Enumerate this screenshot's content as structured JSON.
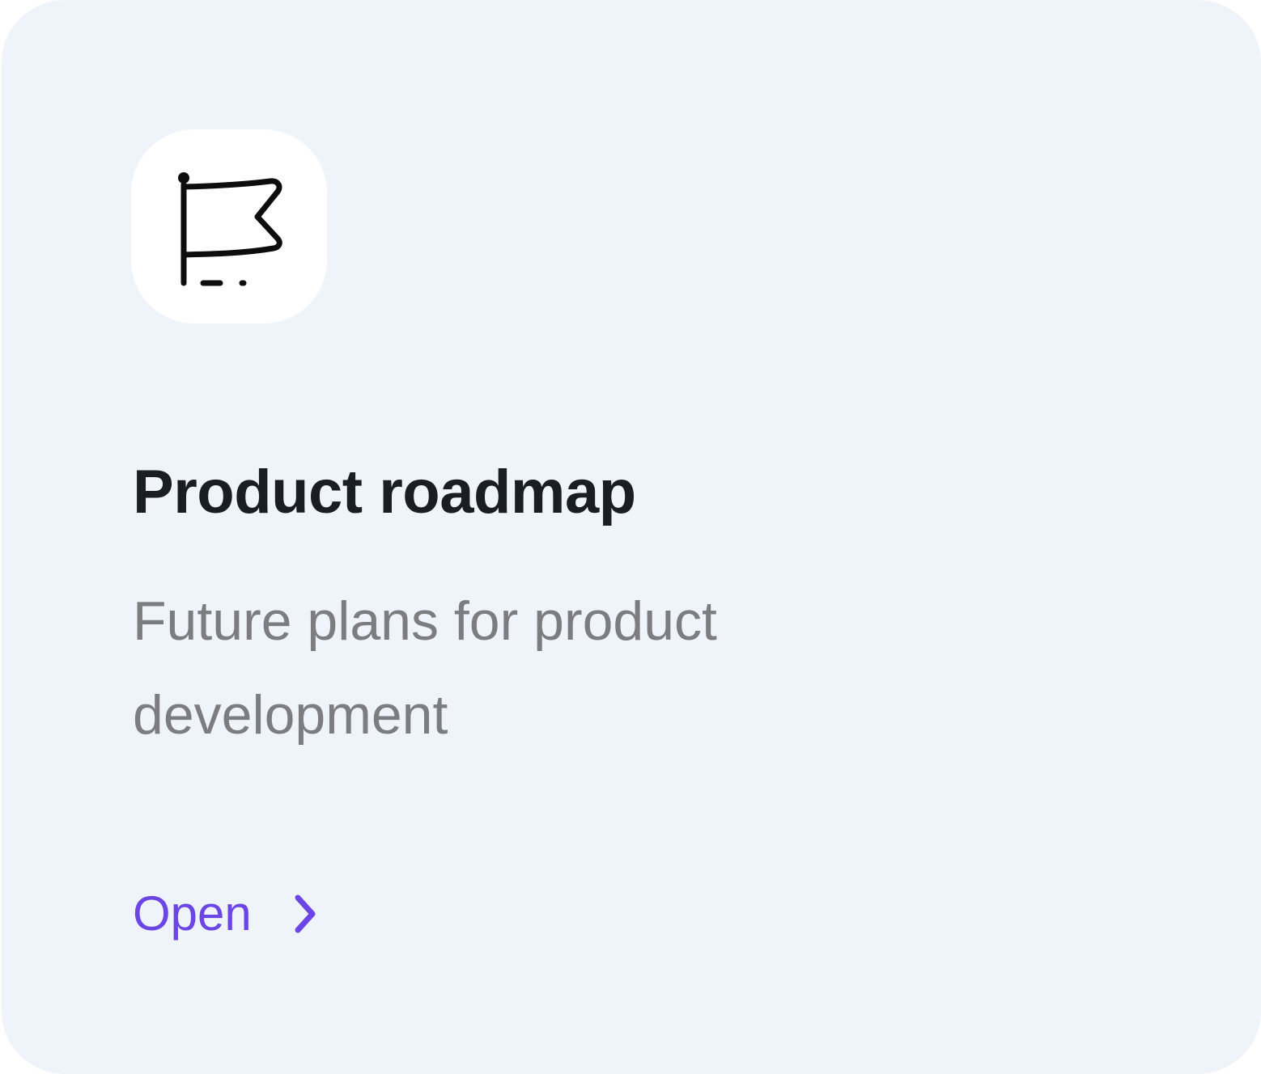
{
  "card": {
    "icon": "flag-icon",
    "title": "Product roadmap",
    "description": "Future plans for product development",
    "action_label": "Open",
    "action_icon": "chevron-right-icon"
  },
  "colors": {
    "card_background": "#eff3fa",
    "icon_tile_background": "#ffffff",
    "title": "#1a1d21",
    "description": "#7b7d80",
    "accent": "#6b46e5"
  }
}
